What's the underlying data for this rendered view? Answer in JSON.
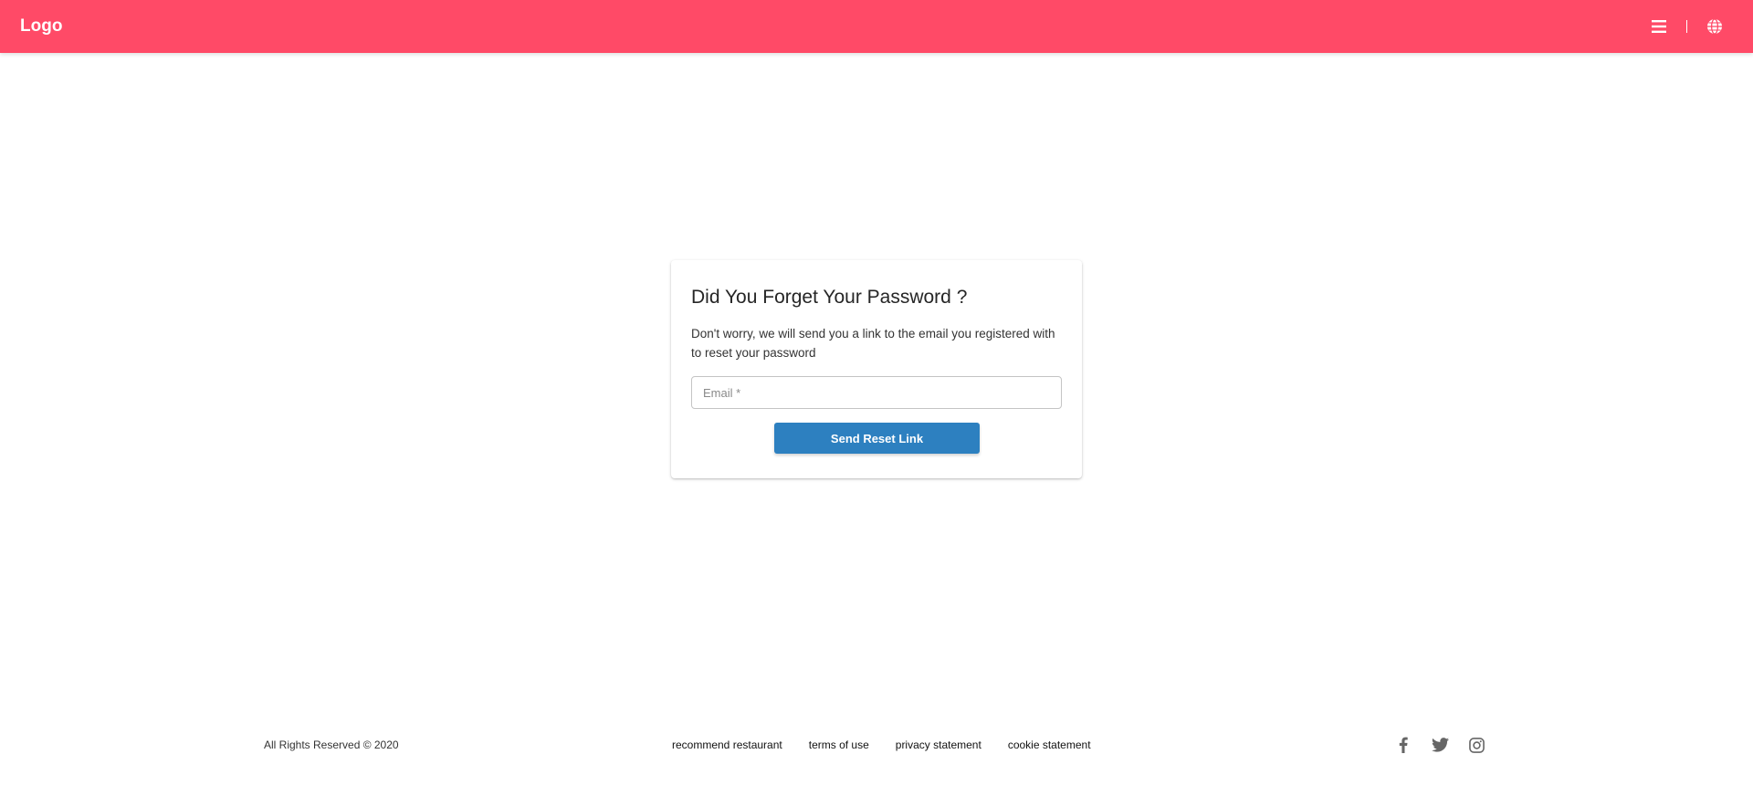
{
  "header": {
    "logo": "Logo",
    "icons": [
      "menu-icon",
      "globe-icon"
    ]
  },
  "form": {
    "title": "Did You Forget Your Password ?",
    "description": "Don't worry, we will send you a link to the email you registered with to reset your password",
    "email_placeholder": "Email *",
    "email_value": "",
    "submit_label": "Send Reset Link"
  },
  "footer": {
    "copyright": "All Rights Reserved © 2020",
    "links": [
      {
        "label": "recommend restaurant"
      },
      {
        "label": "terms of use"
      },
      {
        "label": "privacy statement"
      },
      {
        "label": "cookie statement"
      }
    ],
    "social": [
      "facebook-icon",
      "twitter-icon",
      "instagram-icon"
    ]
  },
  "colors": {
    "header_bg": "#ff4a67",
    "button_bg": "#2d80c0",
    "social_icon": "#666666"
  }
}
